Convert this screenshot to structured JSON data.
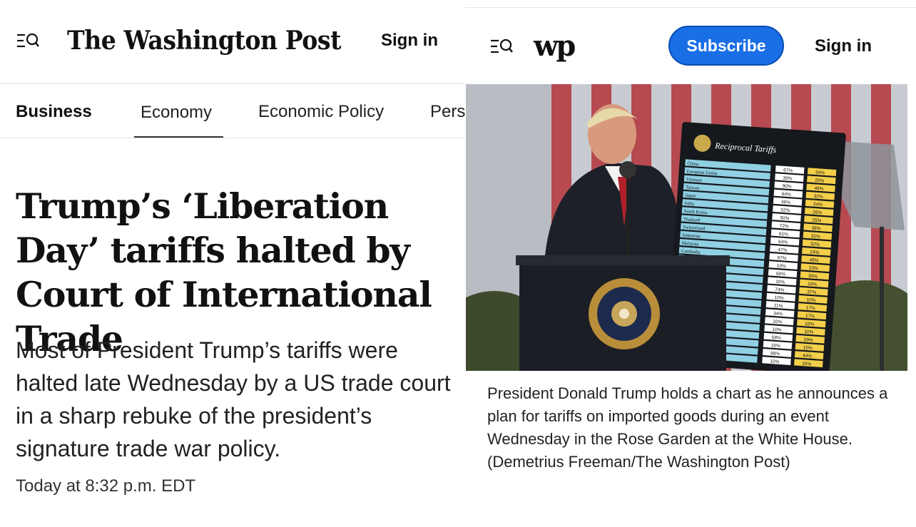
{
  "left": {
    "masthead": "The Washington Post",
    "signin_label": "Sign in",
    "sections": [
      "Business",
      "Economy",
      "Economic Policy",
      "Pers"
    ],
    "headline": "Trump’s ‘Liberation Day’ tariffs halted by Court of International Trade",
    "dek": "Most of President Trump’s tariffs were halted late Wednesday by a US trade court in a sharp rebuke of the president’s signature trade war policy.",
    "timestamp": "Today at 8:32 p.m. EDT"
  },
  "right": {
    "logo": "wp",
    "subscribe_label": "Subscribe",
    "signin_label": "Sign in",
    "photo": {
      "chart_title": "Reciprocal Tariffs",
      "seal_text": "SEAL OF THE PRESIDENT OF THE UNITED STATES",
      "countries": [
        "China",
        "European Union",
        "Vietnam",
        "Taiwan",
        "Japan",
        "India",
        "South Korea",
        "Thailand",
        "Switzerland",
        "Indonesia",
        "Malaysia",
        "Cambodia"
      ],
      "col_changed": [
        "67%",
        "39%",
        "90%",
        "64%",
        "46%",
        "52%",
        "50%",
        "72%",
        "61%",
        "64%",
        "47%",
        "97%",
        "10%",
        "60%",
        "10%",
        "74%",
        "10%",
        "11%",
        "34%",
        "10%",
        "10%",
        "58%",
        "10%",
        "88%",
        "10%"
      ],
      "col_reciprocal": [
        "34%",
        "20%",
        "46%",
        "32%",
        "24%",
        "26%",
        "25%",
        "36%",
        "31%",
        "32%",
        "24%",
        "49%",
        "10%",
        "30%",
        "10%",
        "37%",
        "10%",
        "17%",
        "17%",
        "10%",
        "10%",
        "29%",
        "10%",
        "44%",
        "10%"
      ]
    },
    "caption": "President Donald Trump holds a chart as he announces a plan for tariffs on imported goods during an event Wednesday in the Rose Garden at the White House. (Demetrius Freeman/The Washington Post)"
  },
  "colors": {
    "subscribe_bg": "#1a6ee6",
    "text": "#111111"
  },
  "icons": [
    "menu-search-icon"
  ]
}
